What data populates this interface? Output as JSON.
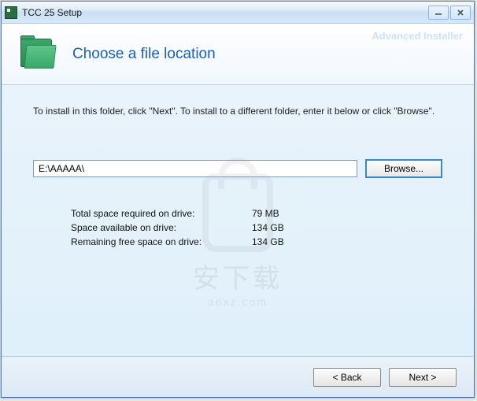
{
  "window": {
    "title": "TCC 25 Setup",
    "brand": "Advanced Installer"
  },
  "header": {
    "heading": "Choose a file location"
  },
  "body": {
    "instruction": "To install in this folder, click \"Next\". To install to a different folder, enter it below or click \"Browse\".",
    "path_value": "E:\\AAAAA\\",
    "browse_label": "Browse...",
    "space": {
      "required_label": "Total space required on drive:",
      "required_value": "79 MB",
      "available_label": "Space available on drive:",
      "available_value": "134 GB",
      "remaining_label": "Remaining free space on drive:",
      "remaining_value": "134 GB"
    }
  },
  "footer": {
    "back_label": "< Back",
    "next_label": "Next >"
  },
  "watermark": {
    "text": "安下载",
    "sub": "anxz.com"
  }
}
